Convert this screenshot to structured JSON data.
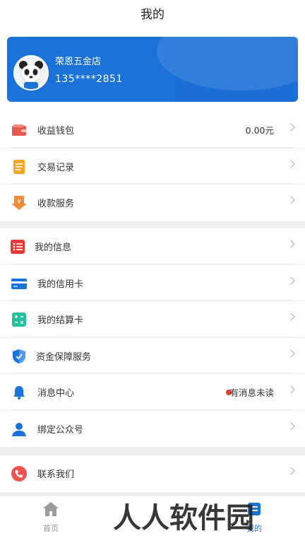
{
  "header": {
    "title": "我的"
  },
  "profile": {
    "shop_name": "荣恩五金店",
    "phone": "135****2851"
  },
  "group1": [
    {
      "label": "收益钱包",
      "value": "0.00元",
      "icon": "wallet-icon"
    },
    {
      "label": "交易记录",
      "icon": "document-icon"
    },
    {
      "label": "收款服务",
      "icon": "yuan-download-icon"
    }
  ],
  "group2": [
    {
      "label": "我的信息",
      "icon": "list-icon"
    },
    {
      "label": "我的信用卡",
      "icon": "credit-card-icon"
    },
    {
      "label": "我的结算卡",
      "icon": "calculator-icon"
    },
    {
      "label": "资金保障服务",
      "icon": "shield-icon"
    },
    {
      "label": "消息中心",
      "value": "有消息未读",
      "icon": "bell-icon"
    },
    {
      "label": "绑定公众号",
      "icon": "person-icon"
    }
  ],
  "group3": [
    {
      "label": "联系我们",
      "icon": "phone-icon"
    }
  ],
  "tabbar": {
    "home": "首页",
    "mine": "我的"
  },
  "watermark": "人人软件园",
  "colors": {
    "accent": "#1a73d9",
    "wallet": "#e85a4f",
    "record": "#f5a623",
    "collect": "#f08c3a",
    "info": "#e53935",
    "card": "#1a73d9",
    "settle": "#26bfa0",
    "shield": "#1a73d9",
    "bell": "#1a73d9",
    "person": "#1a73d9",
    "phone": "#ef5350",
    "unread_dot": "#e53935"
  }
}
